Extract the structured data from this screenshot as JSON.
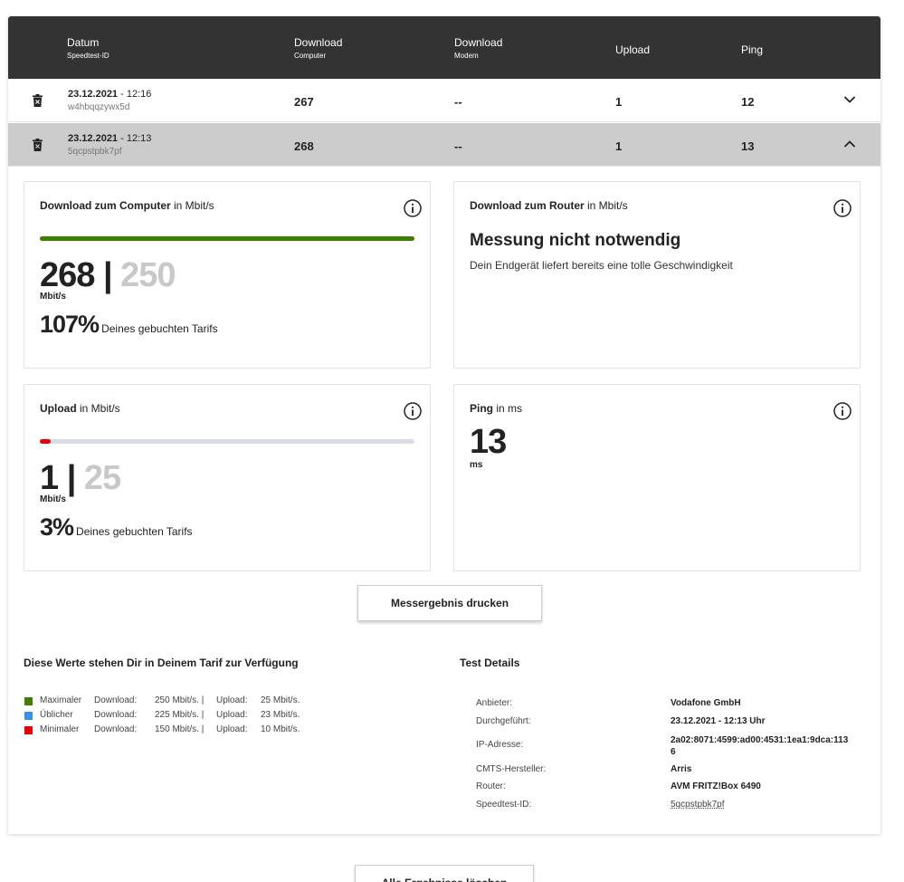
{
  "table": {
    "headers": [
      {
        "main": "Datum",
        "sub": "Speedtest-ID"
      },
      {
        "main": "Download",
        "sub": "Computer"
      },
      {
        "main": "Download",
        "sub": "Modem"
      },
      {
        "main": "Upload",
        "sub": ""
      },
      {
        "main": "Ping",
        "sub": ""
      }
    ],
    "rows": [
      {
        "date": "23.12.2021",
        "time": " - 12:16",
        "id": "w4hbqqzywx5d",
        "download_computer": "267",
        "download_modem": "--",
        "upload": "1",
        "ping": "12",
        "expanded": false
      },
      {
        "date": "23.12.2021",
        "time": " - 12:13",
        "id": "5qcpstpbk7pf",
        "download_computer": "268",
        "download_modem": "--",
        "upload": "1",
        "ping": "13",
        "expanded": true
      }
    ]
  },
  "cards": {
    "download_computer": {
      "title": "Download zum Computer",
      "unit_label": " in Mbit/s",
      "value": "268",
      "separator": " | ",
      "tariff": "250",
      "unit": "Mbit/s",
      "percent": "107%",
      "percent_text": "Deines gebuchten Tarifs",
      "progress": 1.0,
      "bar_color": "#3f7f00"
    },
    "download_router": {
      "title": "Download zum Router",
      "unit_label": " in Mbit/s",
      "headline": "Messung nicht notwendig",
      "text": "Dein Endgerät liefert bereits eine tolle Geschwindigkeit"
    },
    "upload": {
      "title": "Upload",
      "unit_label": " in Mbit/s",
      "value": "1",
      "separator": " | ",
      "tariff": "25",
      "unit": "Mbit/s",
      "percent": "3%",
      "percent_text": "Deines gebuchten Tarifs",
      "progress": 0.03,
      "bar_color": "#e60000"
    },
    "ping": {
      "title": "Ping",
      "unit_label": " in ms",
      "value": "13",
      "unit": "ms"
    }
  },
  "print_button": "Messergebnis drucken",
  "tariff": {
    "title": "Diese Werte stehen Dir in Deinem Tarif zur Verfügung",
    "rows": [
      {
        "name": "Maximaler",
        "dl_label": "Download:",
        "dl": "250 Mbit/s. |",
        "ul_label": "Upload:",
        "ul": "25 Mbit/s.",
        "color": "#3f7f00"
      },
      {
        "name": "Üblicher",
        "dl_label": "Download:",
        "dl": "225 Mbit/s. |",
        "ul_label": "Upload:",
        "ul": "23 Mbit/s.",
        "color": "#3a8fe6"
      },
      {
        "name": "Minimaler",
        "dl_label": "Download:",
        "dl": "150 Mbit/s. |",
        "ul_label": "Upload:",
        "ul": "10 Mbit/s.",
        "color": "#e60000"
      }
    ]
  },
  "details": {
    "title": "Test Details",
    "rows": [
      {
        "label": "Anbieter:",
        "value": "Vodafone GmbH"
      },
      {
        "label": "Durchgeführt:",
        "value": "23.12.2021 - 12:13 Uhr"
      },
      {
        "label": "IP-Adresse:",
        "value": "2a02:8071:4599:ad00:4531:1ea1:9dca:1136"
      },
      {
        "label": "CMTS-Hersteller:",
        "value": "Arris"
      },
      {
        "label": "Router:",
        "value": "AVM FRITZ!Box 6490"
      },
      {
        "label": "Speedtest-ID:",
        "value": "5qcpstpbk7pf"
      }
    ]
  },
  "delete_all_button": "Alle Ergebnisse löschen"
}
